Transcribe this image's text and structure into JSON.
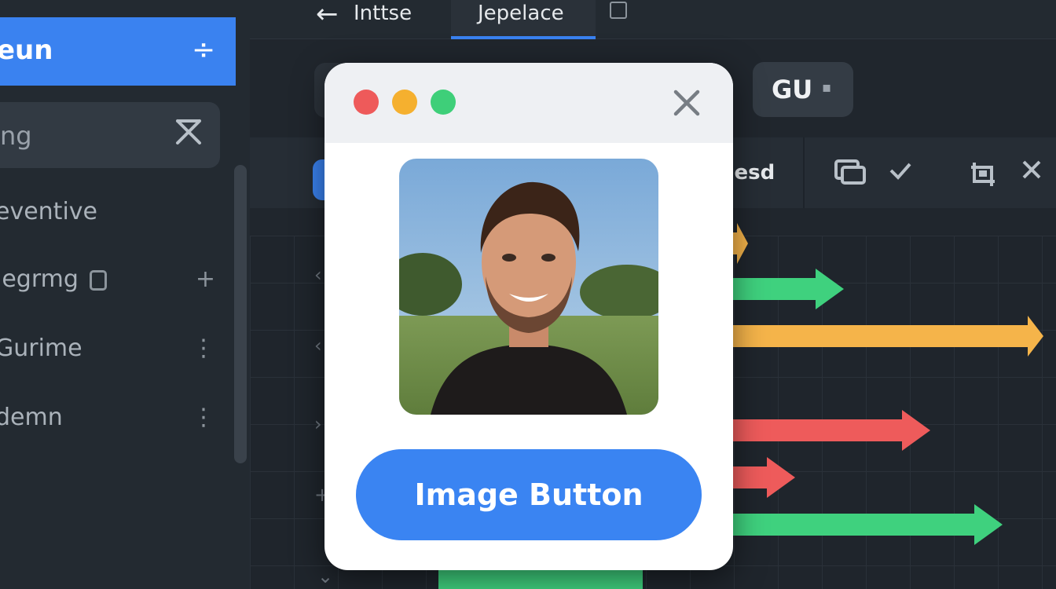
{
  "sidebar": {
    "active_item": {
      "label": "eun",
      "icon": "divide-icon"
    },
    "search": {
      "value": "ng"
    },
    "items": [
      {
        "label": "eventive",
        "trail": ""
      },
      {
        "label": "legrmg",
        "trail": "+"
      },
      {
        "label": "Gurime",
        "trail": "⋮"
      },
      {
        "label": "demn",
        "trail": "⋮"
      }
    ]
  },
  "topbar": {
    "tabs": [
      {
        "label": "Inttse"
      },
      {
        "label": "Jepelace",
        "active": true
      }
    ]
  },
  "controls": {
    "gu_button": "GU"
  },
  "toolbar": {
    "text": "uesd"
  },
  "modal": {
    "traffic_lights": [
      "#ee5a5a",
      "#f5b02f",
      "#3ecf79"
    ],
    "button_label": "Image Button"
  },
  "colors": {
    "accent": "#3a82f0",
    "bar_green": "#3fd17e",
    "bar_orange": "#f5b44a",
    "bar_red": "#ee5b5b"
  }
}
